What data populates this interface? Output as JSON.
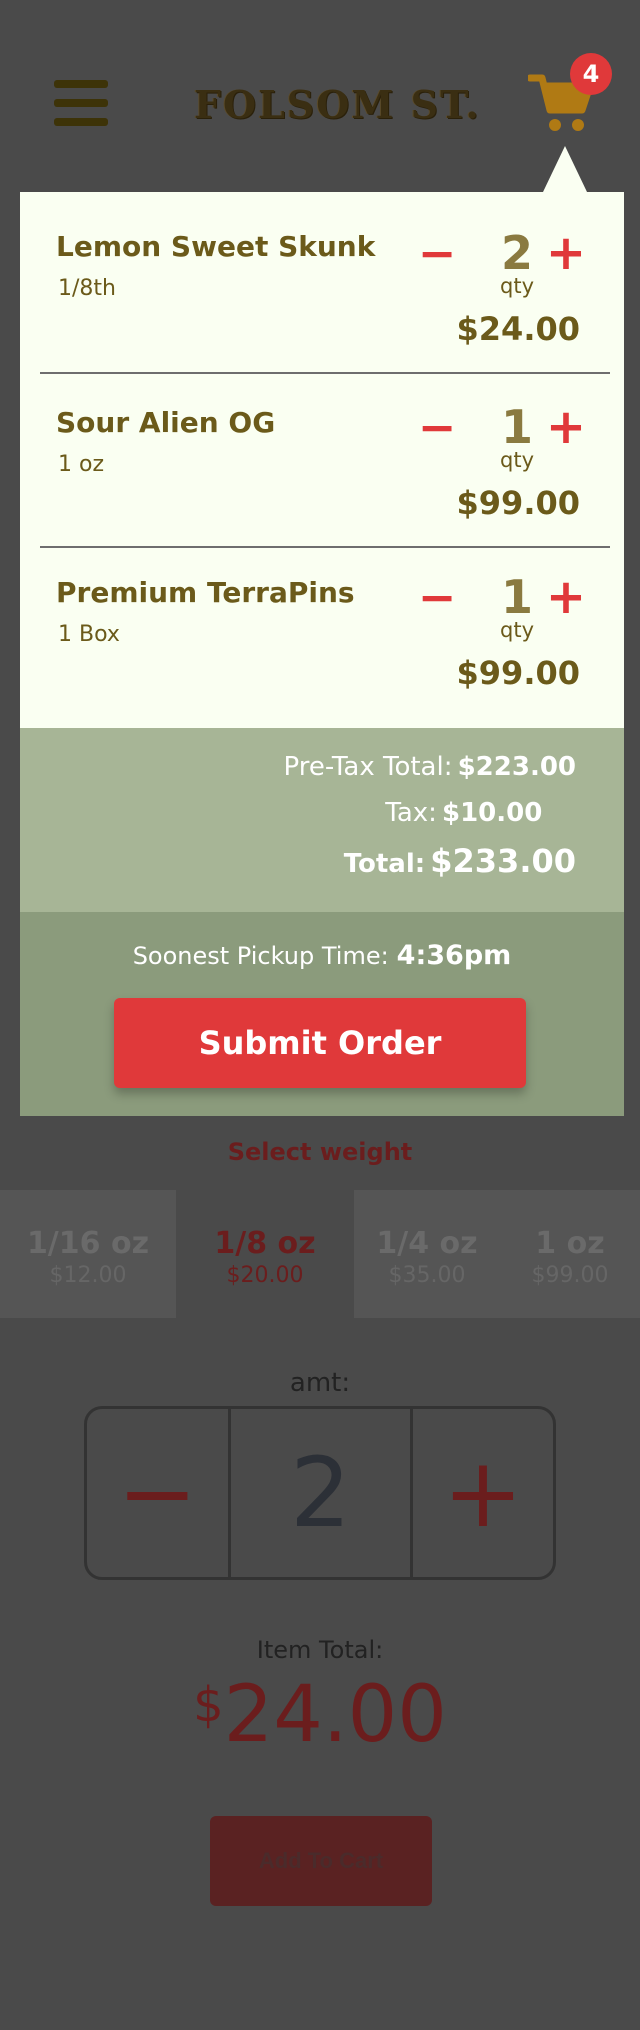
{
  "header": {
    "brand": "FOLSOM ST.",
    "cart_count": "4"
  },
  "cart": {
    "qty_label": "qty",
    "minus_symbol": "−",
    "plus_symbol": "+",
    "items": [
      {
        "name": "Lemon Sweet Skunk",
        "variant": "1/8th",
        "qty": "2",
        "price": "$24.00"
      },
      {
        "name": "Sour Alien OG",
        "variant": "1 oz",
        "qty": "1",
        "price": "$99.00"
      },
      {
        "name": "Premium TerraPins",
        "variant": "1 Box",
        "qty": "1",
        "price": "$99.00"
      }
    ],
    "totals": {
      "pretax_label": "Pre-Tax Total:",
      "pretax_value": "$223.00",
      "tax_label": "Tax:",
      "tax_value": "$10.00",
      "total_label": "Total:",
      "total_value": "$233.00"
    },
    "pickup": {
      "label": "Soonest Pickup Time:",
      "time": "4:36pm"
    },
    "submit_label": "Submit Order"
  },
  "product": {
    "select_weight_label": "Select weight",
    "weights": [
      {
        "label": "1/16 oz",
        "price": "$12.00",
        "selected": false
      },
      {
        "label": "1/8 oz",
        "price": "$20.00",
        "selected": true
      },
      {
        "label": "1/4 oz",
        "price": "$35.00",
        "selected": false
      },
      {
        "label": "1 oz",
        "price": "$99.00",
        "selected": false
      }
    ],
    "amt_label": "amt:",
    "amount": "2",
    "item_total_label": "Item Total:",
    "item_total_currency": "$",
    "item_total_amount": "24.00",
    "add_to_cart_label": "Add To Cart"
  },
  "colors": {
    "accent_red": "#e0393a",
    "brand_brown": "#6b5a1a",
    "cart_bg": "#fafff2",
    "totals_bg": "#a7b596",
    "pickup_bg": "#8b9b7c",
    "cart_icon": "#b07a14"
  },
  "icons": {
    "menu": "hamburger-menu-icon",
    "cart": "shopping-cart-icon"
  }
}
